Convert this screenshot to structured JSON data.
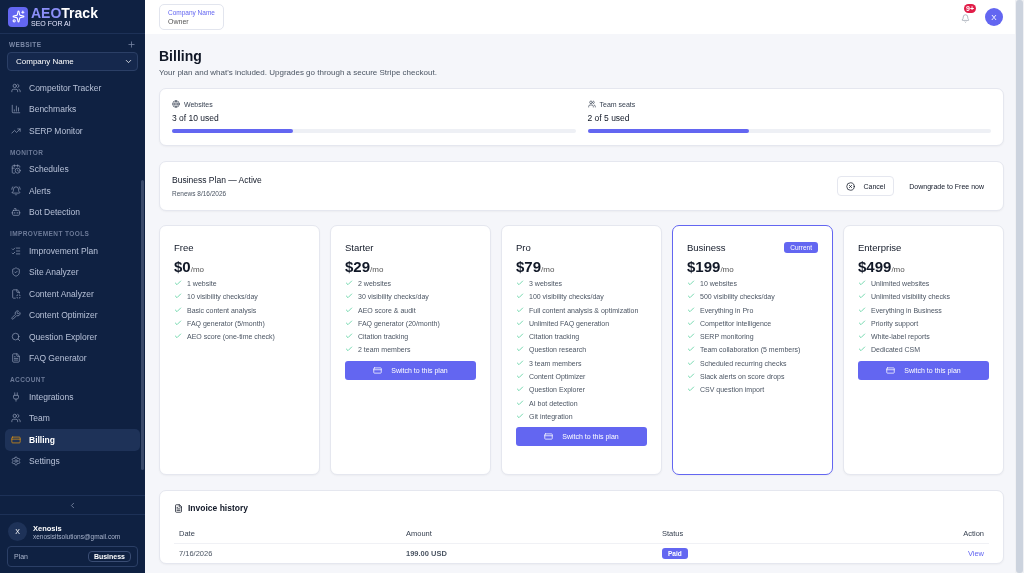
{
  "sidebar": {
    "logo": {
      "title_a": "AEO",
      "title_b": "Track",
      "subtitle": "SEO FOR AI"
    },
    "website_label": "WEBSITE",
    "website_select": "Company Name",
    "groups": [
      {
        "items": [
          {
            "label": "Competitor Tracker",
            "selected": false
          },
          {
            "label": "Benchmarks",
            "selected": false
          },
          {
            "label": "SERP Monitor",
            "selected": false
          }
        ]
      },
      {
        "label": "MONITOR",
        "items": [
          {
            "label": "Schedules",
            "selected": false
          },
          {
            "label": "Alerts",
            "selected": false
          },
          {
            "label": "Bot Detection",
            "selected": false
          }
        ]
      },
      {
        "label": "IMPROVEMENT TOOLS",
        "items": [
          {
            "label": "Improvement Plan",
            "selected": false
          },
          {
            "label": "Site Analyzer",
            "selected": false
          },
          {
            "label": "Content Analyzer",
            "selected": false
          },
          {
            "label": "Content Optimizer",
            "selected": false
          },
          {
            "label": "Question Explorer",
            "selected": false
          },
          {
            "label": "FAQ Generator",
            "selected": false
          }
        ]
      },
      {
        "label": "ACCOUNT",
        "items": [
          {
            "label": "Integrations",
            "selected": false
          },
          {
            "label": "Team",
            "selected": false
          },
          {
            "label": "Billing",
            "selected": true
          },
          {
            "label": "Settings",
            "selected": false
          }
        ]
      }
    ],
    "user": {
      "initial": "X",
      "name": "Xenosis",
      "email": "xenosisitsolutions@gmail.com"
    },
    "plan": {
      "label": "Plan",
      "value": "Business"
    }
  },
  "header": {
    "company": {
      "name": "Company Name",
      "role": "Owner"
    },
    "notification_badge": "9+",
    "avatar": "X"
  },
  "page": {
    "title": "Billing",
    "subtitle": "Your plan and what's included. Upgrades go through a secure Stripe checkout."
  },
  "usage": [
    {
      "label": "Websites",
      "reading": "3 of 10 used",
      "level": 0.3
    },
    {
      "label": "Team seats",
      "reading": "2 of 5 used",
      "level": 0.4
    }
  ],
  "status": {
    "title": "Business Plan — Active",
    "renews": "Renews 8/16/2026",
    "cancel": "Cancel",
    "downgrade": "Downgrade to Free now"
  },
  "plans": [
    {
      "name": "Free",
      "price": "$0",
      "period": "/mo",
      "selected": false,
      "features": [
        "1 website",
        "10 visibility checks/day",
        "Basic content analysis",
        "FAQ generator (5/month)",
        "AEO score (one-time check)"
      ]
    },
    {
      "name": "Starter",
      "price": "$29",
      "period": "/mo",
      "selected": false,
      "features": [
        "2 websites",
        "30 visibility checks/day",
        "AEO score & audit",
        "FAQ generator (20/month)",
        "Citation tracking",
        "2 team members"
      ],
      "button": "Switch to this plan"
    },
    {
      "name": "Pro",
      "price": "$79",
      "period": "/mo",
      "selected": false,
      "features": [
        "3 websites",
        "100 visibility checks/day",
        "Full content analysis & optimization",
        "Unlimited FAQ generation",
        "Citation tracking",
        "Question research",
        "3 team members",
        "Content Optimizer",
        "Question Explorer",
        "AI bot detection",
        "Git integration"
      ],
      "button": "Switch to this plan"
    },
    {
      "name": "Business",
      "price": "$199",
      "period": "/mo",
      "selected": true,
      "badge": "Current",
      "features": [
        "10 websites",
        "500 visibility checks/day",
        "Everything in Pro",
        "Competitor intelligence",
        "SERP monitoring",
        "Team collaboration (5 members)",
        "Scheduled recurring checks",
        "Slack alerts on score drops",
        "CSV question import"
      ]
    },
    {
      "name": "Enterprise",
      "price": "$499",
      "period": "/mo",
      "selected": false,
      "features": [
        "Unlimited websites",
        "Unlimited visibility checks",
        "Everything in Business",
        "Priority support",
        "White-label reports",
        "Dedicated CSM"
      ],
      "button": "Switch to this plan"
    }
  ],
  "invoices": {
    "title": "Invoice history",
    "columns": [
      "Date",
      "Amount",
      "Status",
      "Action"
    ],
    "rows": [
      {
        "date": "7/16/2026",
        "amount": "199.00 USD",
        "status": "Paid",
        "action": "View"
      }
    ]
  }
}
